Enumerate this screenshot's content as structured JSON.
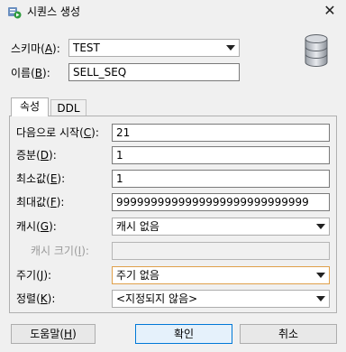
{
  "window": {
    "title": "시퀀스 생성",
    "close_glyph": "✕"
  },
  "schema": {
    "label": "스키마",
    "mnemonic": "A",
    "value": "TEST"
  },
  "name": {
    "label": "이름",
    "mnemonic": "B",
    "value": "SELL_SEQ"
  },
  "tabs": [
    {
      "label": "속성"
    },
    {
      "label": "DDL"
    }
  ],
  "properties": {
    "start_with": {
      "label": "다음으로 시작",
      "mnemonic": "C",
      "value": "21"
    },
    "increment": {
      "label": "증분",
      "mnemonic": "D",
      "value": "1"
    },
    "min_value": {
      "label": "최소값",
      "mnemonic": "E",
      "value": "1"
    },
    "max_value": {
      "label": "최대값",
      "mnemonic": "F",
      "value": "9999999999999999999999999999"
    },
    "cache": {
      "label": "캐시",
      "mnemonic": "G",
      "value": "캐시 없음"
    },
    "cache_size": {
      "label": "캐시 크기",
      "mnemonic": "I",
      "value": ""
    },
    "cycle": {
      "label": "주기",
      "mnemonic": "J",
      "value": "주기 없음"
    },
    "order": {
      "label": "정렬",
      "mnemonic": "K",
      "value": "<지정되지 않음>"
    }
  },
  "buttons": {
    "help": {
      "label": "도움말",
      "mnemonic": "H"
    },
    "ok": {
      "label": "확인"
    },
    "cancel": {
      "label": "취소"
    }
  },
  "icons": {
    "app": "sequence-app-icon",
    "db": "database-icon"
  },
  "colors": {
    "focus_border": "#e0a04a",
    "default_button_border": "#0078d7"
  }
}
